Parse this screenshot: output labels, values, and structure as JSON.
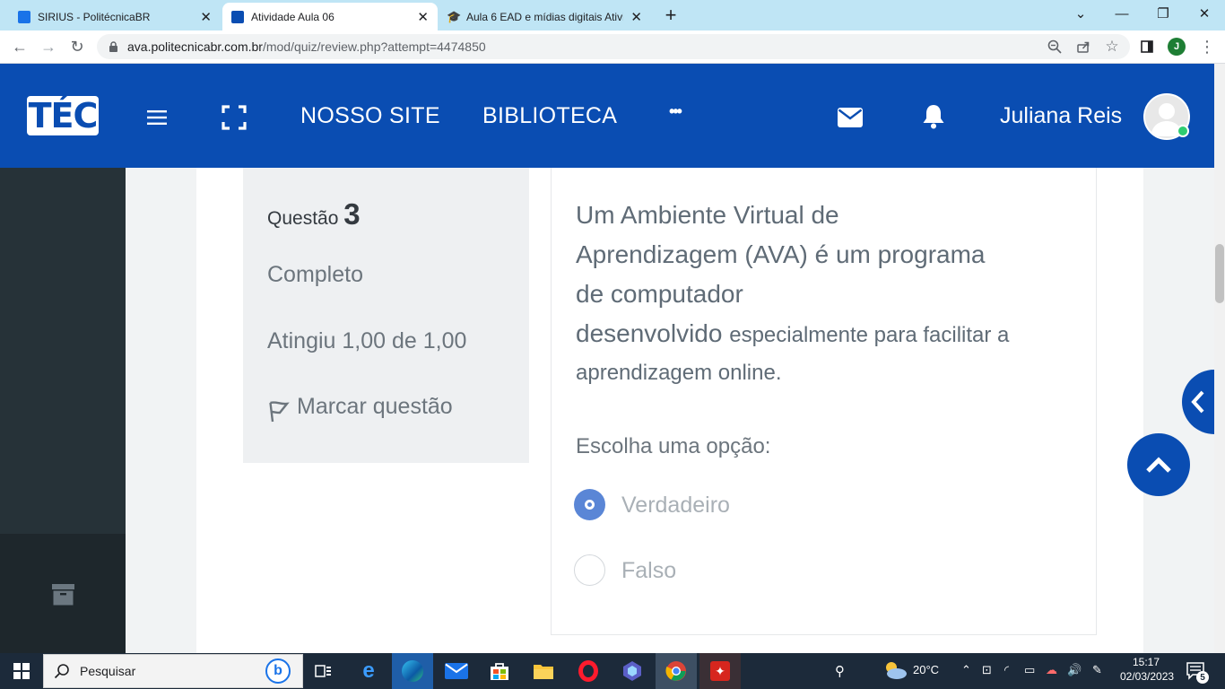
{
  "browser": {
    "tabs": [
      {
        "title": "SIRIUS - PolitécnicaBR",
        "close": "✕"
      },
      {
        "title": "Atividade Aula 06",
        "close": "✕"
      },
      {
        "title": "Aula 6 EAD e mídias digitais Ativi",
        "close": "✕"
      }
    ],
    "new_tab": "+",
    "url_domain": "ava.politecnicabr.com.br",
    "url_path": "/mod/quiz/review.php?attempt=4474850",
    "profile_initial": "J"
  },
  "header": {
    "logo": "TÉC",
    "nav": [
      "NOSSO SITE",
      "BIBLIOTECA"
    ],
    "more": "•••",
    "user_name": "Juliana Reis"
  },
  "question_info": {
    "label": "Questão",
    "number": "3",
    "state": "Completo",
    "grade": "Atingiu 1,00 de 1,00",
    "flag_label": "Marcar questão"
  },
  "question": {
    "lines": [
      "Um Ambiente Virtual de",
      "Aprendizagem (AVA) é um programa",
      "de computador"
    ],
    "line4_a": "desenvolvido",
    "line4_b": "especialmente para facilitar a",
    "line5": "aprendizagem online.",
    "prompt": "Escolha uma opção:",
    "options": [
      {
        "label": "Verdadeiro",
        "selected": true
      },
      {
        "label": "Falso",
        "selected": false
      }
    ]
  },
  "taskbar": {
    "search_placeholder": "Pesquisar",
    "weather": "20°C",
    "time": "15:17",
    "date": "02/03/2023",
    "notifications": "5"
  },
  "colors": {
    "brand": "#0a4db2",
    "sidebar": "#263238",
    "radio_selected": "#5a86d6"
  }
}
